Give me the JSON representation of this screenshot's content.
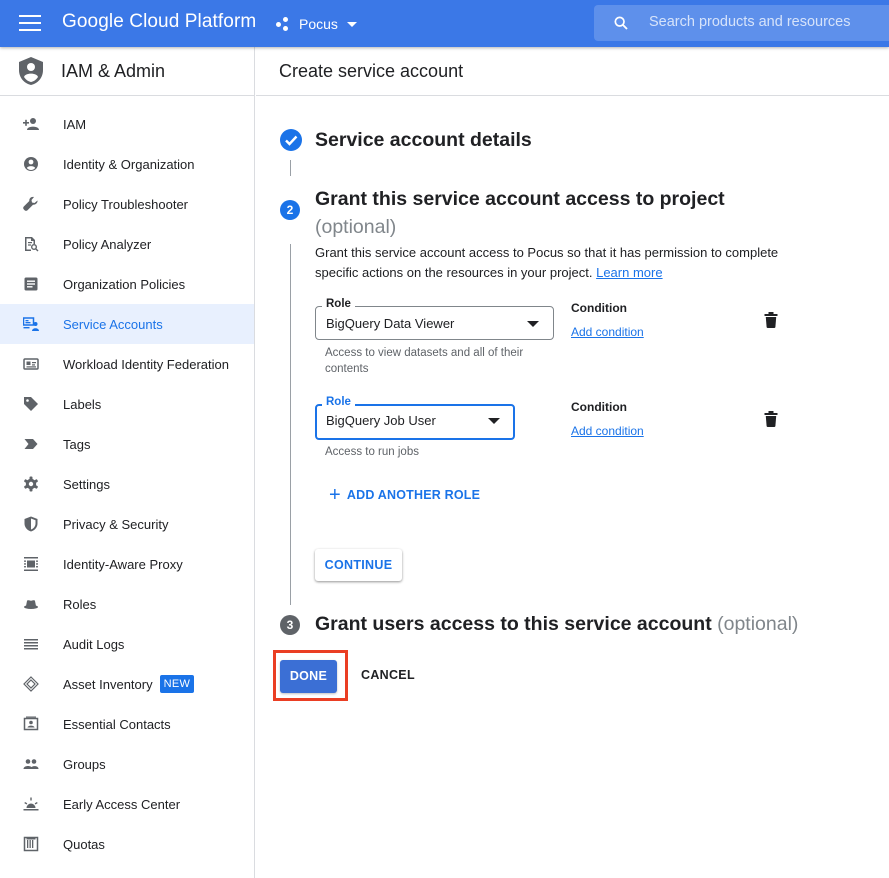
{
  "topbar": {
    "brand": "Google Cloud Platform",
    "project": "Pocus",
    "search_placeholder": "Search products and resources"
  },
  "sidebar": {
    "title": "IAM & Admin",
    "items": [
      {
        "label": "IAM",
        "icon": "person-add-icon"
      },
      {
        "label": "Identity & Organization",
        "icon": "account-circle-icon"
      },
      {
        "label": "Policy Troubleshooter",
        "icon": "wrench-icon"
      },
      {
        "label": "Policy Analyzer",
        "icon": "document-search-icon"
      },
      {
        "label": "Organization Policies",
        "icon": "list-document-icon"
      },
      {
        "label": "Service Accounts",
        "icon": "service-account-icon",
        "active": true
      },
      {
        "label": "Workload Identity Federation",
        "icon": "id-card-icon"
      },
      {
        "label": "Labels",
        "icon": "label-icon"
      },
      {
        "label": "Tags",
        "icon": "tag-arrow-icon"
      },
      {
        "label": "Settings",
        "icon": "gear-icon"
      },
      {
        "label": "Privacy & Security",
        "icon": "shield-icon"
      },
      {
        "label": "Identity-Aware Proxy",
        "icon": "proxy-icon"
      },
      {
        "label": "Roles",
        "icon": "hat-icon"
      },
      {
        "label": "Audit Logs",
        "icon": "lines-icon"
      },
      {
        "label": "Asset Inventory",
        "icon": "diamond-layers-icon",
        "badge": "NEW"
      },
      {
        "label": "Essential Contacts",
        "icon": "contact-card-icon"
      },
      {
        "label": "Groups",
        "icon": "group-icon"
      },
      {
        "label": "Early Access Center",
        "icon": "sunrise-icon"
      },
      {
        "label": "Quotas",
        "icon": "quota-icon"
      }
    ]
  },
  "main": {
    "page_title": "Create service account",
    "step1": {
      "title": "Service account details"
    },
    "step2": {
      "number": "2",
      "title": "Grant this service account access to project",
      "optional": "(optional)",
      "description": "Grant this service account access to Pocus so that it has permission to complete specific actions on the resources in your project.",
      "learn_more": "Learn more",
      "roles": [
        {
          "label": "Role",
          "value": "BigQuery Data Viewer",
          "hint": "Access to view datasets and all of their contents",
          "condition_label": "Condition",
          "condition_link": "Add condition"
        },
        {
          "label": "Role",
          "value": "BigQuery Job User",
          "hint": "Access to run jobs",
          "condition_label": "Condition",
          "condition_link": "Add condition"
        }
      ],
      "add_role": "ADD ANOTHER ROLE",
      "continue": "CONTINUE"
    },
    "step3": {
      "number": "3",
      "title": "Grant users access to this service account",
      "optional": "(optional)"
    },
    "done": "DONE",
    "cancel": "CANCEL"
  },
  "colors": {
    "topbar": "#3b78e7",
    "accent": "#1a73e8",
    "highlight": "#ea3e23"
  }
}
